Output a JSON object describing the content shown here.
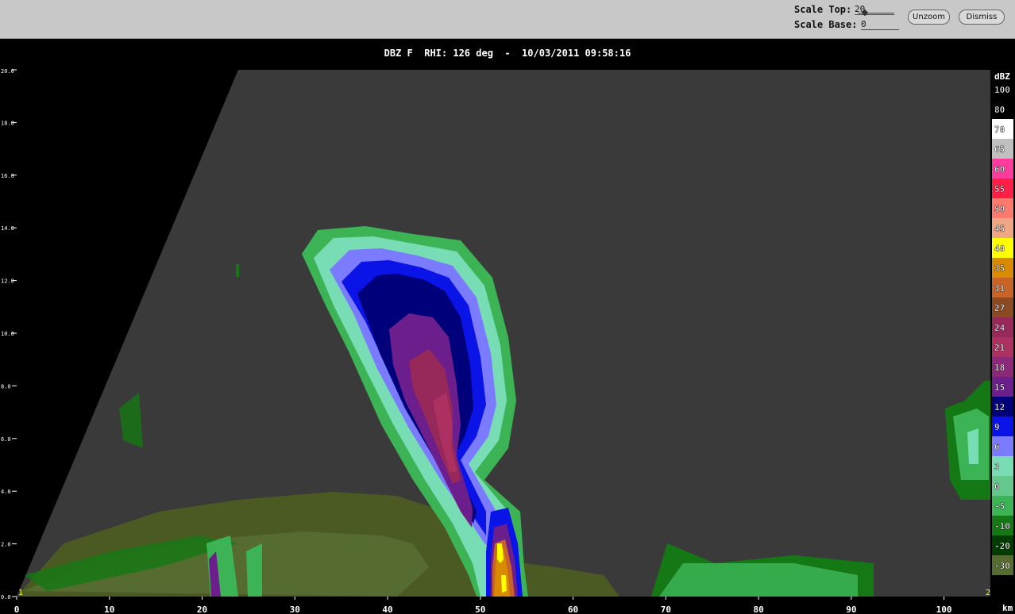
{
  "controls": {
    "scale_top_label": "Scale Top:",
    "scale_top_value": "20",
    "scale_base_label": "Scale Base:",
    "scale_base_value": "0",
    "unzoom_label": "Unzoom",
    "dismiss_label": "Dismiss"
  },
  "header": {
    "title": "DBZ F  RHI: 126 deg  -  10/03/2011 09:58:16"
  },
  "chart_data": {
    "type": "heatmap",
    "title": "DBZ F  RHI: 126 deg  -  10/03/2011 09:58:16",
    "x_unit": "km",
    "x_ticks": [
      "0",
      "10",
      "20",
      "30",
      "40",
      "50",
      "60",
      "70",
      "80",
      "90",
      "100"
    ],
    "y_ticks": [
      "0.0",
      "2.0",
      "4.0",
      "6.0",
      "8.0",
      "10.0",
      "12.0",
      "14.0",
      "16.0",
      "18.0",
      "20.0"
    ],
    "xlim": [
      0,
      105
    ],
    "ylim": [
      0,
      20
    ],
    "corner_markers": [
      "1",
      "2"
    ],
    "colorbar": {
      "unit": "dBZ",
      "labels": [
        "100",
        "80",
        "70",
        "65",
        "60",
        "55",
        "50",
        "45",
        "40",
        "35",
        "31",
        "27",
        "24",
        "21",
        "18",
        "15",
        "12",
        "9",
        "6",
        "3",
        "0",
        "-5",
        "-10",
        "-20",
        "-30"
      ],
      "colors": [
        "#000000",
        "#000000",
        "#ffffff",
        "#c0c0c0",
        "#ff3c9e",
        "#ff1e46",
        "#ff7a6e",
        "#f0a884",
        "#ffff00",
        "#d88a00",
        "#c86428",
        "#8c4a23",
        "#96285a",
        "#ac3060",
        "#8c2878",
        "#6c1e8c",
        "#00007a",
        "#0a14e6",
        "#7b7bff",
        "#78dcb4",
        "#64c88c",
        "#3cb455",
        "#147814",
        "#003c00",
        "#556b2f"
      ]
    }
  }
}
